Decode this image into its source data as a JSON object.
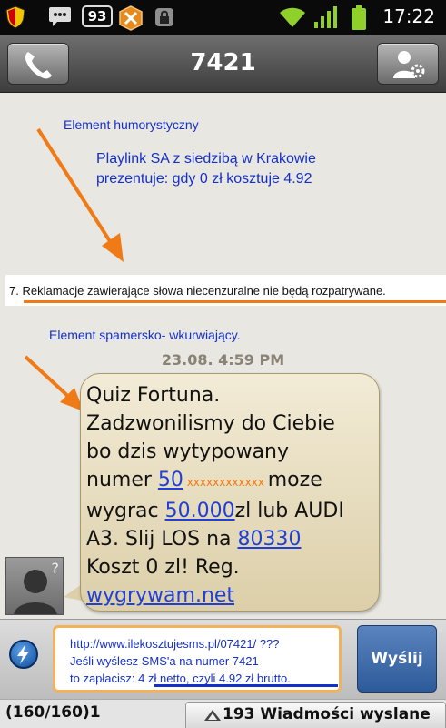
{
  "status_bar": {
    "notification_count": "93",
    "time": "17:22",
    "icons": [
      "shield-icon",
      "chat-icon",
      "crosshair-hex-icon",
      "lock-icon",
      "wifi-icon",
      "signal-icon",
      "battery-icon"
    ]
  },
  "header": {
    "title": "7421",
    "call_icon": "phone-icon",
    "contact_icon": "contact-settings-icon"
  },
  "annotations": {
    "humor_label": "Element humorystyczny",
    "playlink_line1": "Playlink SA z siedzibą w Krakowie",
    "playlink_line2": "prezentuje: gdy 0 zł kosztuje 4.92",
    "terms_text": "7. Reklamacje zawierające słowa niecenzuralne nie będą rozpatrywane.",
    "spam_label": "Element spamersko- wkurwiający.",
    "arrow_color": "#f07a16"
  },
  "conversation": {
    "timestamp": "23.08. 4:59 PM",
    "message": {
      "line1": "Quiz Fortuna.",
      "line2": "Zadzwonilismy do Ciebie",
      "line3": "bo dzis wytypowany",
      "line4_a": "numer ",
      "line4_link": "50",
      "line4_mask": " xxxxxxxxxxxx ",
      "line4_b": " moze",
      "line5_a": "wygrac ",
      "line5_link": "50.000",
      "line5_b": "zl lub AUDI",
      "line6_a": "A3. Slij LOS na ",
      "line6_link": "80330",
      "line7": "Koszt 0 zl! Reg.",
      "line8_link": "wygrywam.net"
    },
    "avatar_mark": "?"
  },
  "compose": {
    "line1": "http://www.ilekosztujesms.pl/07421/ ???",
    "line2": "Jeśli wyślesz SMS'a na numer 7421",
    "line3_a": "to zapłacisz: ",
    "line3_b": "4 zł netto, czyli 4.92 zł brutto.",
    "send_label": "Wyślij",
    "highlight_color": "#f0b25a"
  },
  "bottom_bar": {
    "counter": "(160/160)1",
    "sent_label": "193 Wiadmości wyslane"
  }
}
